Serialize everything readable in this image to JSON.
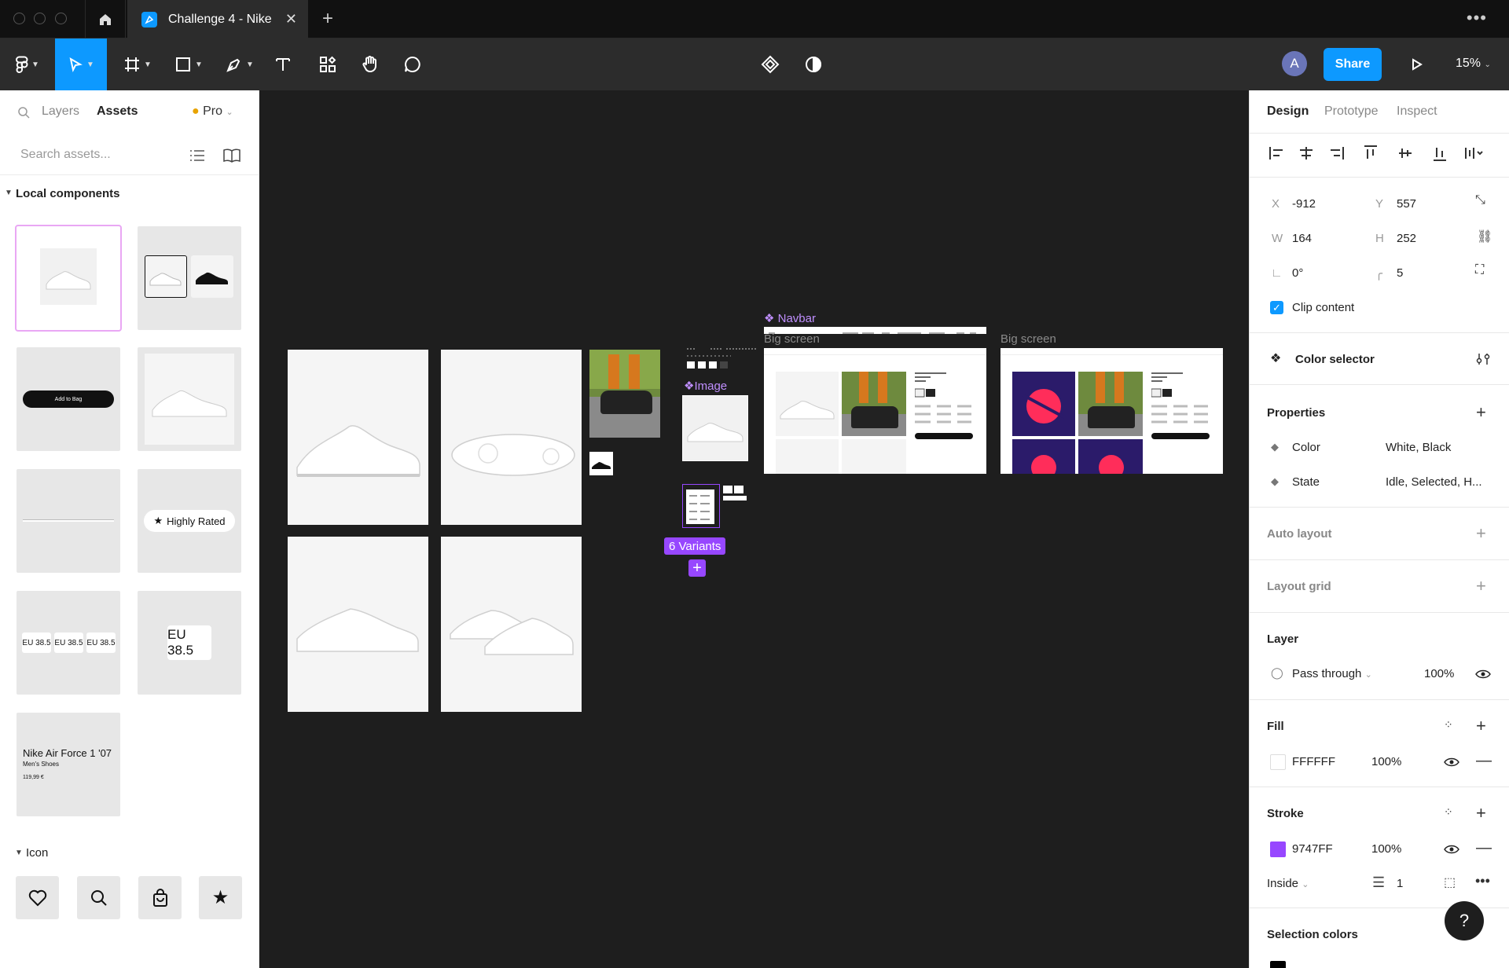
{
  "tab": {
    "title": "Challenge 4 - Nike"
  },
  "toolbar": {
    "avatar_initial": "A",
    "share_label": "Share",
    "zoom": "15%"
  },
  "left_panel": {
    "tabs": [
      "Layers",
      "Assets"
    ],
    "plan": "Pro",
    "search_placeholder": "Search assets...",
    "local_components_title": "Local components",
    "icon_section_title": "Icon",
    "components": {
      "add_to_bag": "Add to Bag",
      "highly_rated": "Highly Rated",
      "size_small": [
        "EU 38.5",
        "EU 38.5",
        "EU 38.5"
      ],
      "size_large": "EU 38.5",
      "product_name": "Nike Air Force 1 '07",
      "product_subtitle": "Men's Shoes",
      "product_price": "119,99 €"
    },
    "icons": [
      "heart-icon",
      "search-icon",
      "bag-icon",
      "star-icon"
    ]
  },
  "canvas": {
    "navbar_label": "Navbar",
    "image_label": "Image",
    "big_screen_labels": [
      "Big screen",
      "Big screen"
    ],
    "variants_badge": "6 Variants"
  },
  "right_panel": {
    "tabs": [
      "Design",
      "Prototype",
      "Inspect"
    ],
    "x_label": "X",
    "x": "-912",
    "y_label": "Y",
    "y": "557",
    "w_label": "W",
    "w": "164",
    "h_label": "H",
    "h": "252",
    "rotation": "0°",
    "radius": "5",
    "clip_content": "Clip content",
    "component_name": "Color selector",
    "properties_title": "Properties",
    "properties": [
      {
        "name": "Color",
        "value": "White, Black"
      },
      {
        "name": "State",
        "value": "Idle, Selected, H..."
      }
    ],
    "auto_layout": "Auto layout",
    "layout_grid": "Layout grid",
    "layer_title": "Layer",
    "blend_mode": "Pass through",
    "layer_opacity": "100%",
    "fill_title": "Fill",
    "fill_hex": "FFFFFF",
    "fill_opacity": "100%",
    "fill_color": "#FFFFFF",
    "stroke_title": "Stroke",
    "stroke_hex": "9747FF",
    "stroke_opacity": "100%",
    "stroke_color": "#9747FF",
    "stroke_position": "Inside",
    "stroke_weight": "1",
    "selection_colors_title": "Selection colors"
  },
  "colors": {
    "accent": "#0d99ff",
    "component_purple": "#9747FF"
  }
}
